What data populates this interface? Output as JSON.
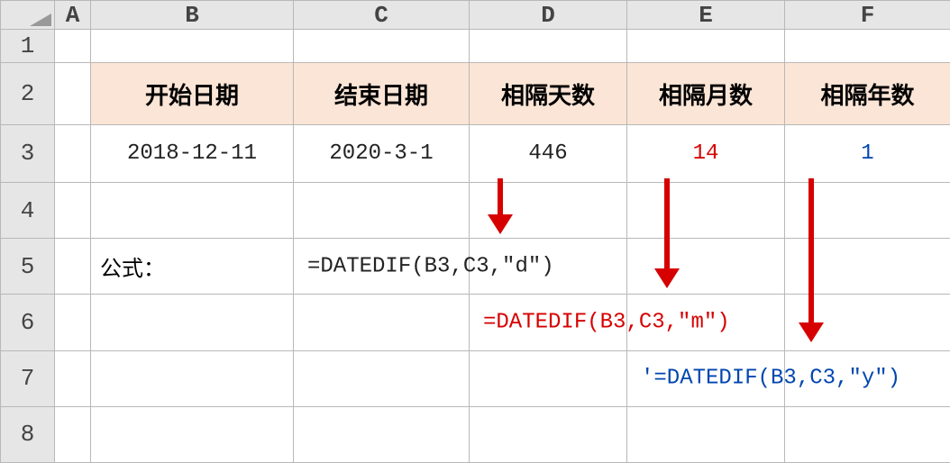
{
  "columns": [
    "A",
    "B",
    "C",
    "D",
    "E",
    "F"
  ],
  "rows": [
    "1",
    "2",
    "3",
    "4",
    "5",
    "6",
    "7",
    "8"
  ],
  "headers": {
    "B": "开始日期",
    "C": "结束日期",
    "D": "相隔天数",
    "E": "相隔月数",
    "F": "相隔年数"
  },
  "data": {
    "start_date": "2018-12-11",
    "end_date": "2020-3-1",
    "days": "446",
    "months": "14",
    "years": "1"
  },
  "labels": {
    "formula": "公式："
  },
  "formulas": {
    "d": "=DATEDIF(B3,C3,\"d\")",
    "m": "=DATEDIF(B3,C3,\"m\")",
    "y": "'=DATEDIF(B3,C3,\"y\")"
  }
}
